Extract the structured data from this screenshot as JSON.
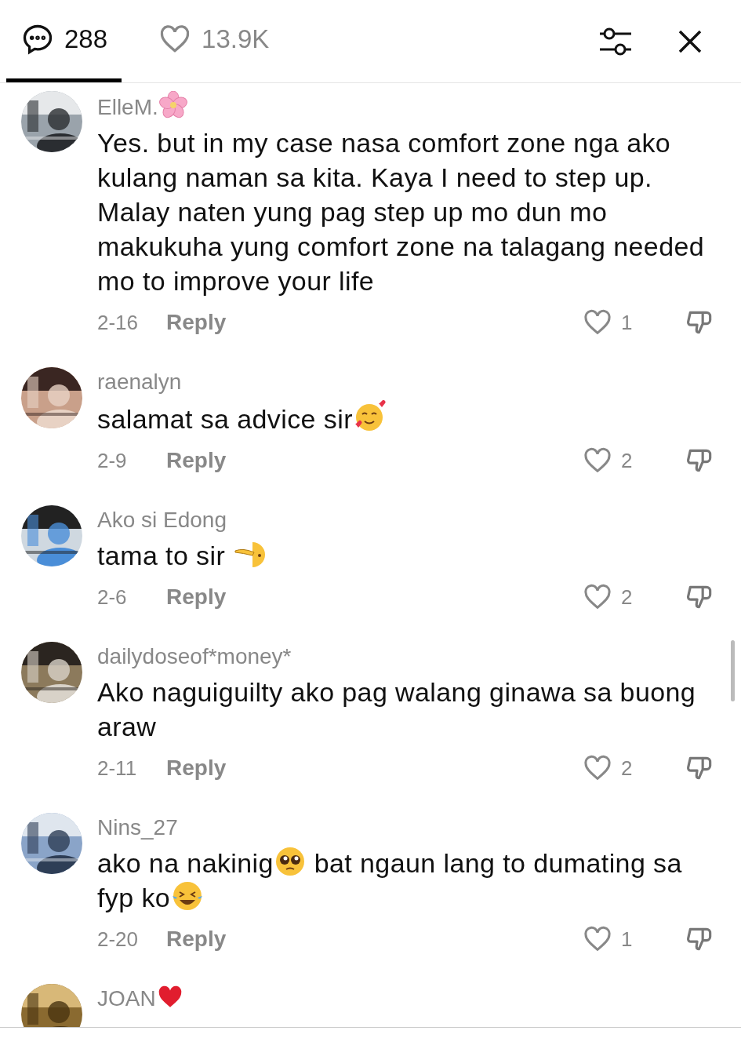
{
  "tabs": [
    {
      "kind": "comments",
      "label": "288",
      "selected": true
    },
    {
      "kind": "likes",
      "label": "13.9K",
      "selected": false
    }
  ],
  "comments": [
    {
      "user": [
        {
          "kind": "text",
          "text": "ElleM."
        },
        {
          "kind": "blossom"
        }
      ],
      "body": [
        {
          "kind": "text",
          "text": "Yes. but in my case nasa comfort zone nga ako kulang naman sa kita. Kaya I need to step up. Malay naten yung pag step up mo dun mo makukuha yung comfort zone na talagang needed mo to improve your life"
        }
      ],
      "date": "2-16",
      "reply": "Reply",
      "likes": "1",
      "avatar": {
        "kind": "picture"
      }
    },
    {
      "user": [
        {
          "kind": "text",
          "text": "raenalyn"
        }
      ],
      "body": [
        {
          "kind": "text",
          "text": "salamat sa advice sir"
        },
        {
          "kind": "hearts-face"
        }
      ],
      "date": "2-9",
      "reply": "Reply",
      "likes": "2",
      "avatar": {
        "kind": "picture"
      }
    },
    {
      "user": [
        {
          "kind": "text",
          "text": "Ako si Edong"
        }
      ],
      "body": [
        {
          "kind": "text",
          "text": "tama to sir "
        },
        {
          "kind": "salute-face"
        }
      ],
      "date": "2-6",
      "reply": "Reply",
      "likes": "2",
      "avatar": {
        "kind": "picture"
      }
    },
    {
      "user": [
        {
          "kind": "text",
          "text": "dailydoseof*money*"
        }
      ],
      "body": [
        {
          "kind": "text",
          "text": "Ako naguiguilty ako pag walang ginawa sa buong araw"
        }
      ],
      "date": "2-11",
      "reply": "Reply",
      "likes": "2",
      "avatar": {
        "kind": "picture"
      }
    },
    {
      "user": [
        {
          "kind": "text",
          "text": "Nins_27"
        }
      ],
      "body": [
        {
          "kind": "text",
          "text": "ako na nakinig"
        },
        {
          "kind": "pleading-face"
        },
        {
          "kind": "text",
          "text": " bat ngaun lang to dumating sa fyp ko"
        },
        {
          "kind": "laughing-face"
        }
      ],
      "date": "2-20",
      "reply": "Reply",
      "likes": "1",
      "avatar": {
        "kind": "picture"
      }
    },
    {
      "user": [
        {
          "kind": "text",
          "text": "JOAN"
        },
        {
          "kind": "heart"
        }
      ],
      "avatar": {
        "kind": "picture"
      }
    }
  ]
}
